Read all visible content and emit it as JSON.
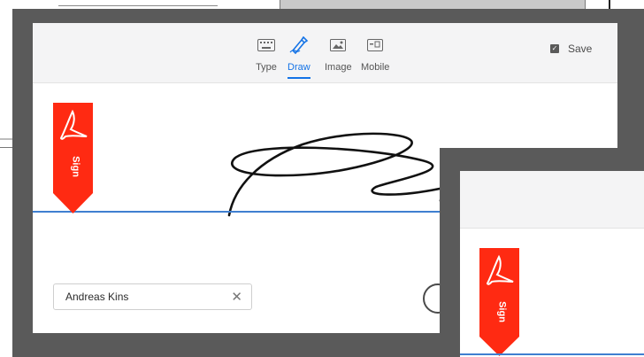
{
  "tabs": [
    {
      "label": "Type",
      "icon": "keyboard-icon",
      "active": false
    },
    {
      "label": "Draw",
      "icon": "pen-draw-icon",
      "active": true
    },
    {
      "label": "Image",
      "icon": "image-icon",
      "active": false
    },
    {
      "label": "Mobile",
      "icon": "mobile-icon",
      "active": false
    }
  ],
  "save": {
    "label": "Save",
    "checked": true
  },
  "sign_tag": {
    "label": "Sign",
    "color": "#ff2a12"
  },
  "name_field": {
    "value": "Andreas Kins",
    "clear_icon": "close-icon"
  },
  "colors": {
    "accent": "#1473e6",
    "baseline": "#3f7fd0",
    "frame": "#5a5a5a"
  }
}
